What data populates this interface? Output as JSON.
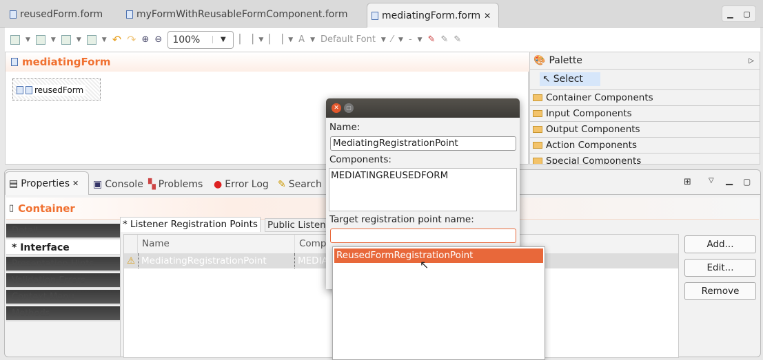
{
  "editor_tabs": [
    {
      "label": "reusedForm.form"
    },
    {
      "label": "myFormWithReusableFormComponent.form"
    },
    {
      "label": "mediatingForm.form",
      "active": true
    }
  ],
  "toolbar": {
    "zoom": "100%",
    "font": "Default Font",
    "font_color_label": "A",
    "line_style": "-"
  },
  "editor": {
    "form_title": "mediatingForm",
    "component_label": "reusedForm"
  },
  "palette": {
    "title": "Palette",
    "select": "Select",
    "groups": [
      "Container Components",
      "Input Components",
      "Output Components",
      "Action Components",
      "Special Components"
    ]
  },
  "bottom_tabs": [
    {
      "label": "Properties",
      "active": true
    },
    {
      "label": "Console"
    },
    {
      "label": "Problems"
    },
    {
      "label": "Error Log"
    },
    {
      "label": "Search"
    }
  ],
  "properties": {
    "title": "Container",
    "sections": [
      "Detail",
      "* Interface",
      "Presentation Hints",
      "Validation Errors",
      "Context Menu",
      "Methods"
    ],
    "subtabs": [
      "* Listener Registration Points",
      "Public Listen"
    ],
    "table": {
      "headers": [
        "Name",
        "Comp"
      ],
      "rows": [
        {
          "name": "MediatingRegistrationPoint",
          "component": "MEDIA",
          "warning": true
        }
      ]
    },
    "buttons": {
      "add": "Add...",
      "edit": "Edit...",
      "remove": "Remove"
    }
  },
  "dialog": {
    "name_label": "Name:",
    "name_value": "MediatingRegistrationPoint",
    "components_label": "Components:",
    "components_value": "MEDIATINGREUSEDFORM",
    "target_label": "Target registration point name:",
    "target_value": "",
    "suggestions": [
      "ReusedFormRegistrationPoint"
    ]
  },
  "colors": {
    "accent": "#f07030",
    "selection": "#e8683a"
  }
}
